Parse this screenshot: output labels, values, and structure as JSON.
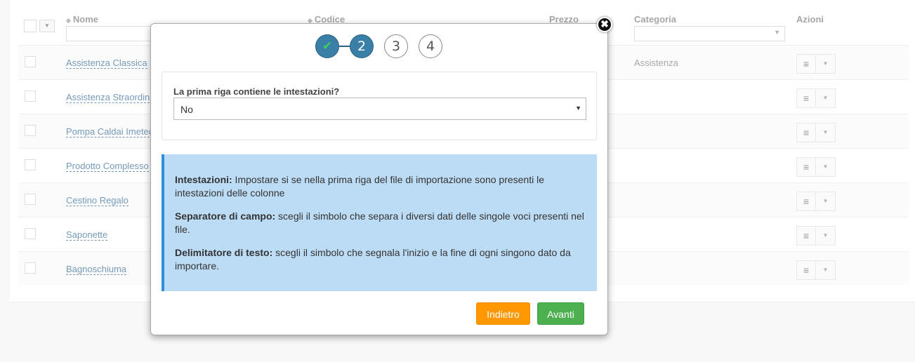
{
  "table": {
    "headers": {
      "name": "Nome",
      "code": "Codice",
      "price": "Prezzo",
      "category": "Categoria",
      "actions": "Azioni"
    },
    "rows": [
      {
        "name": "Assistenza Classica",
        "category": "Assistenza"
      },
      {
        "name": "Assistenza Straordin",
        "category": ""
      },
      {
        "name": "Pompa Caldai Imetec",
        "category": ""
      },
      {
        "name": "Prodotto Complesso",
        "category": ""
      },
      {
        "name": "Cestino Regalo",
        "category": ""
      },
      {
        "name": "Saponette",
        "category": ""
      },
      {
        "name": "Bagnoschiuma",
        "category": ""
      }
    ]
  },
  "wizard": {
    "steps": [
      "✔",
      "2",
      "3",
      "4"
    ],
    "current_step": 2,
    "close_symbol": "✖",
    "header_question": "La prima riga contiene le intestazioni?",
    "header_value": "No",
    "info": [
      {
        "title": "Intestazioni:",
        "text": " Impostare si se nella prima riga del file di importazione sono presenti le intestazioni delle colonne"
      },
      {
        "title": "Separatore di campo:",
        "text": " scegli il simbolo che separa i diversi dati delle singole voci presenti nel file."
      },
      {
        "title": "Delimitatore di testo:",
        "text": " scegli il simbolo che segnala l'inizio e la fine di ogni singono dato da importare."
      }
    ],
    "back_label": "Indietro",
    "next_label": "Avanti"
  },
  "colors": {
    "step_active": "#3a7fa6",
    "info_bg": "#bcdcf5",
    "info_border": "#2c8fe0",
    "back_button": "#ff9800",
    "next_button": "#4caf50",
    "link": "#2a6496"
  }
}
